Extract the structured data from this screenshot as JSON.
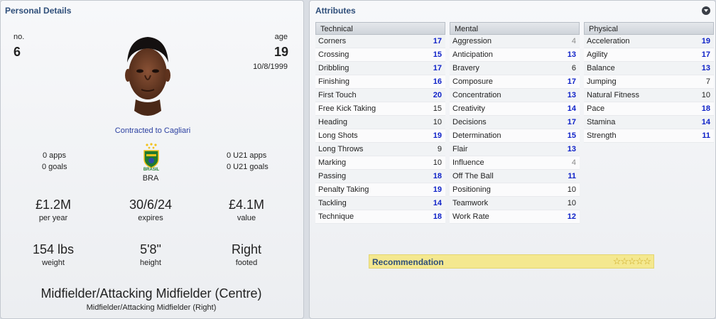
{
  "personal": {
    "title": "Personal Details",
    "no_label": "no.",
    "no_value": "6",
    "age_label": "age",
    "age_value": "19",
    "dob": "10/8/1999",
    "contract": "Contracted to Cagliari",
    "apps": "0 apps",
    "goals": "0 goals",
    "u21_apps": "0 U21 apps",
    "u21_goals": "0 U21 goals",
    "nation_badge_text": "BRASIL",
    "nation": "BRA",
    "wage_value": "£1.2M",
    "wage_label": "per year",
    "expires_value": "30/6/24",
    "expires_label": "expires",
    "value_value": "£4.1M",
    "value_label": "value",
    "weight_value": "154 lbs",
    "weight_label": "weight",
    "height_value": "5'8\"",
    "height_label": "height",
    "foot_value": "Right",
    "foot_label": "footed",
    "position_main": "Midfielder/Attacking Midfielder (Centre)",
    "position_sub": "Midfielder/Attacking Midfielder (Right)"
  },
  "attributes": {
    "title": "Attributes",
    "columns": [
      {
        "header": "Technical",
        "rows": [
          {
            "name": "Corners",
            "value": "17",
            "tone": "blue"
          },
          {
            "name": "Crossing",
            "value": "15",
            "tone": "blue"
          },
          {
            "name": "Dribbling",
            "value": "17",
            "tone": "blue"
          },
          {
            "name": "Finishing",
            "value": "16",
            "tone": "blue"
          },
          {
            "name": "First Touch",
            "value": "20",
            "tone": "blue"
          },
          {
            "name": "Free Kick Taking",
            "value": "15",
            "tone": "black"
          },
          {
            "name": "Heading",
            "value": "10",
            "tone": "black"
          },
          {
            "name": "Long Shots",
            "value": "19",
            "tone": "blue"
          },
          {
            "name": "Long Throws",
            "value": "9",
            "tone": "black"
          },
          {
            "name": "Marking",
            "value": "10",
            "tone": "black"
          },
          {
            "name": "Passing",
            "value": "18",
            "tone": "blue"
          },
          {
            "name": "Penalty Taking",
            "value": "19",
            "tone": "blue"
          },
          {
            "name": "Tackling",
            "value": "14",
            "tone": "blue"
          },
          {
            "name": "Technique",
            "value": "18",
            "tone": "blue"
          }
        ]
      },
      {
        "header": "Mental",
        "rows": [
          {
            "name": "Aggression",
            "value": "4",
            "tone": "grey"
          },
          {
            "name": "Anticipation",
            "value": "13",
            "tone": "blue"
          },
          {
            "name": "Bravery",
            "value": "6",
            "tone": "black"
          },
          {
            "name": "Composure",
            "value": "17",
            "tone": "blue"
          },
          {
            "name": "Concentration",
            "value": "13",
            "tone": "blue"
          },
          {
            "name": "Creativity",
            "value": "14",
            "tone": "blue"
          },
          {
            "name": "Decisions",
            "value": "17",
            "tone": "blue"
          },
          {
            "name": "Determination",
            "value": "15",
            "tone": "blue"
          },
          {
            "name": "Flair",
            "value": "13",
            "tone": "blue"
          },
          {
            "name": "Influence",
            "value": "4",
            "tone": "grey"
          },
          {
            "name": "Off The Ball",
            "value": "11",
            "tone": "blue"
          },
          {
            "name": "Positioning",
            "value": "10",
            "tone": "black"
          },
          {
            "name": "Teamwork",
            "value": "10",
            "tone": "black"
          },
          {
            "name": "Work Rate",
            "value": "12",
            "tone": "blue"
          }
        ]
      },
      {
        "header": "Physical",
        "rows": [
          {
            "name": "Acceleration",
            "value": "19",
            "tone": "blue"
          },
          {
            "name": "Agility",
            "value": "17",
            "tone": "blue"
          },
          {
            "name": "Balance",
            "value": "13",
            "tone": "blue"
          },
          {
            "name": "Jumping",
            "value": "7",
            "tone": "black"
          },
          {
            "name": "Natural Fitness",
            "value": "10",
            "tone": "black"
          },
          {
            "name": "Pace",
            "value": "18",
            "tone": "blue"
          },
          {
            "name": "Stamina",
            "value": "14",
            "tone": "blue"
          },
          {
            "name": "Strength",
            "value": "11",
            "tone": "blue"
          }
        ]
      }
    ],
    "recommendation_label": "Recommendation",
    "recommendation_stars": 5
  },
  "colors": {
    "title_blue": "#2f4f7a",
    "value_blue": "#0f22c8",
    "recommend_bg": "#f4e88f"
  }
}
